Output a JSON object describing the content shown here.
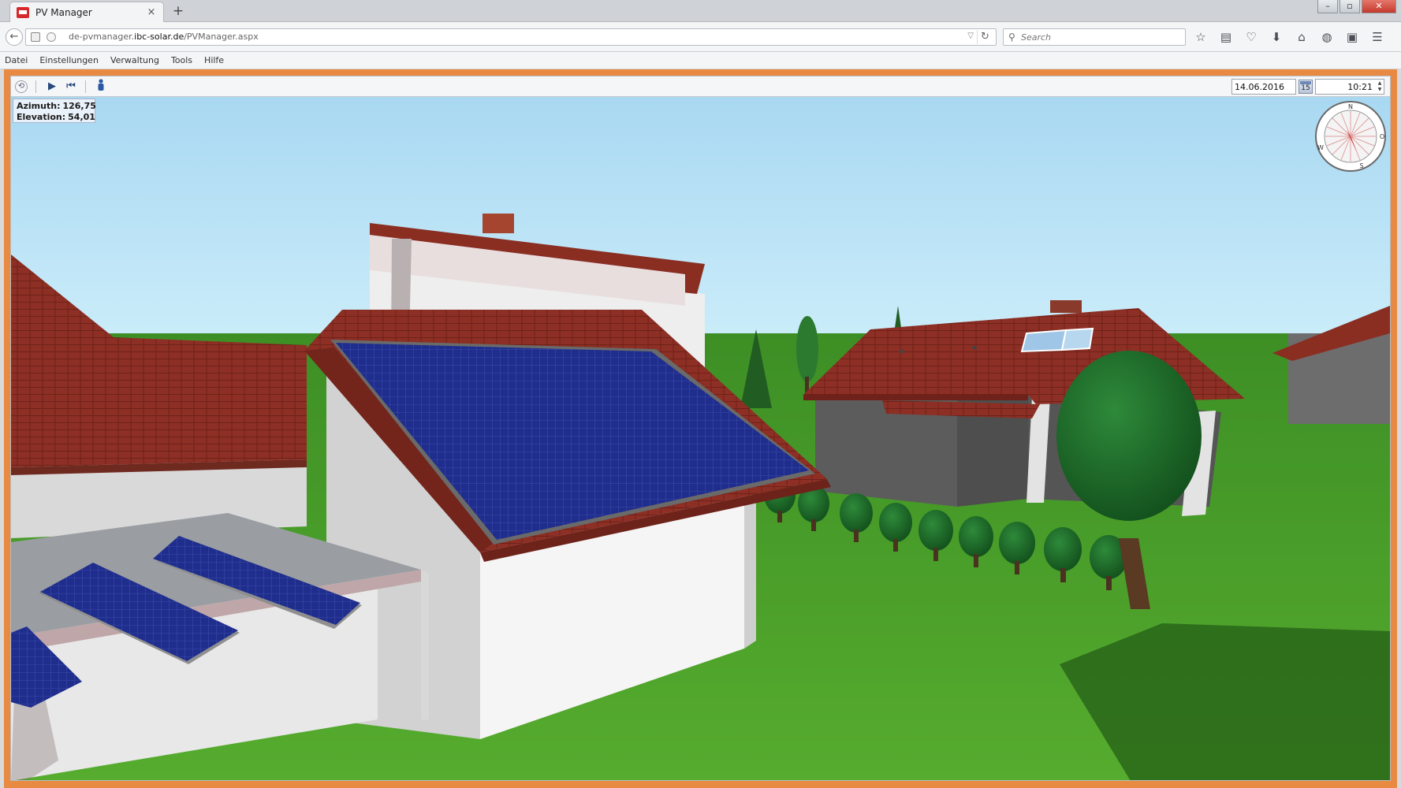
{
  "browser": {
    "tab_title": "PV Manager",
    "tab_close": "×",
    "new_tab": "+",
    "url_prefix": "de-pvmanager.",
    "url_domain": "ibc-solar.de",
    "url_path": "/PVManager.aspx",
    "search_placeholder": "Search"
  },
  "menu": {
    "items": [
      "Datei",
      "Einstellungen",
      "Verwaltung",
      "Tools",
      "Hilfe"
    ]
  },
  "toolbar": {
    "date": "14.06.2016",
    "calendar_day": "15",
    "time": "10:21"
  },
  "sun_info": {
    "azimuth_label": "Azimuth:",
    "azimuth_value": "126,75",
    "elevation_label": "Elevation:",
    "elevation_value": "54,01"
  },
  "compass": {
    "labels": [
      "N",
      "O",
      "S",
      "W"
    ]
  },
  "colors": {
    "app_border": "#e98a42",
    "sky": "#b4dff4",
    "grass": "#4ea22a",
    "roof_tile": "#8b2d22",
    "solar_panel": "#1d2c8a",
    "wall": "#ececec"
  }
}
